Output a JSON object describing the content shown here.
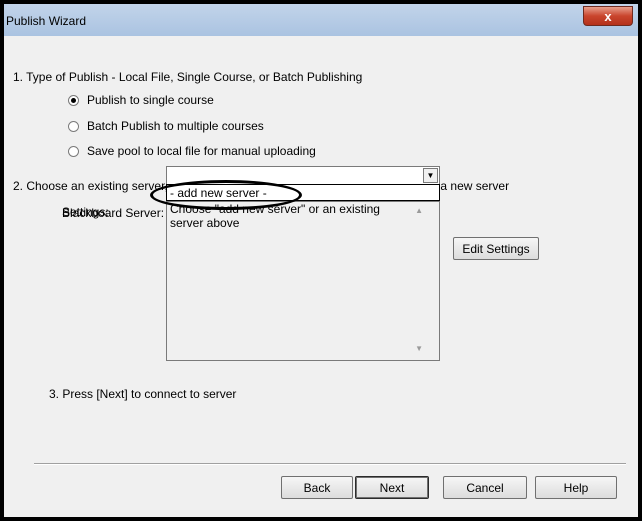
{
  "window": {
    "title": "Publish Wizard",
    "close_glyph": "x"
  },
  "step1": {
    "heading": "1.  Type of Publish - Local File, Single Course, or Batch Publishing",
    "options": [
      {
        "label": "Publish to single course",
        "selected": true
      },
      {
        "label": "Batch Publish to multiple courses",
        "selected": false
      },
      {
        "label": "Save pool to local file for manual uploading",
        "selected": false
      }
    ]
  },
  "step2": {
    "heading": "2.  Choose an existing server, or \"add new server\" to add settings information for a new server",
    "server_label": "Blackboard Server:",
    "server_value": "",
    "dropdown_options": [
      "- add new server -"
    ],
    "settings_label": "Settings:",
    "settings_text": "Choose \"add new server\" or an existing server above",
    "edit_settings_label": "Edit Settings"
  },
  "step3": {
    "heading": "3.  Press [Next] to connect to server"
  },
  "buttons": {
    "back": "Back",
    "next": "Next",
    "cancel": "Cancel",
    "help": "Help"
  },
  "colors": {
    "titlebar": "#aac3e1",
    "client": "#f0f0f0",
    "close": "#c9452d"
  },
  "icons": {
    "close": "close-icon",
    "combo_arrow": "chevron-down-icon",
    "scroll_up": "scroll-up-icon",
    "scroll_down": "scroll-down-icon"
  }
}
